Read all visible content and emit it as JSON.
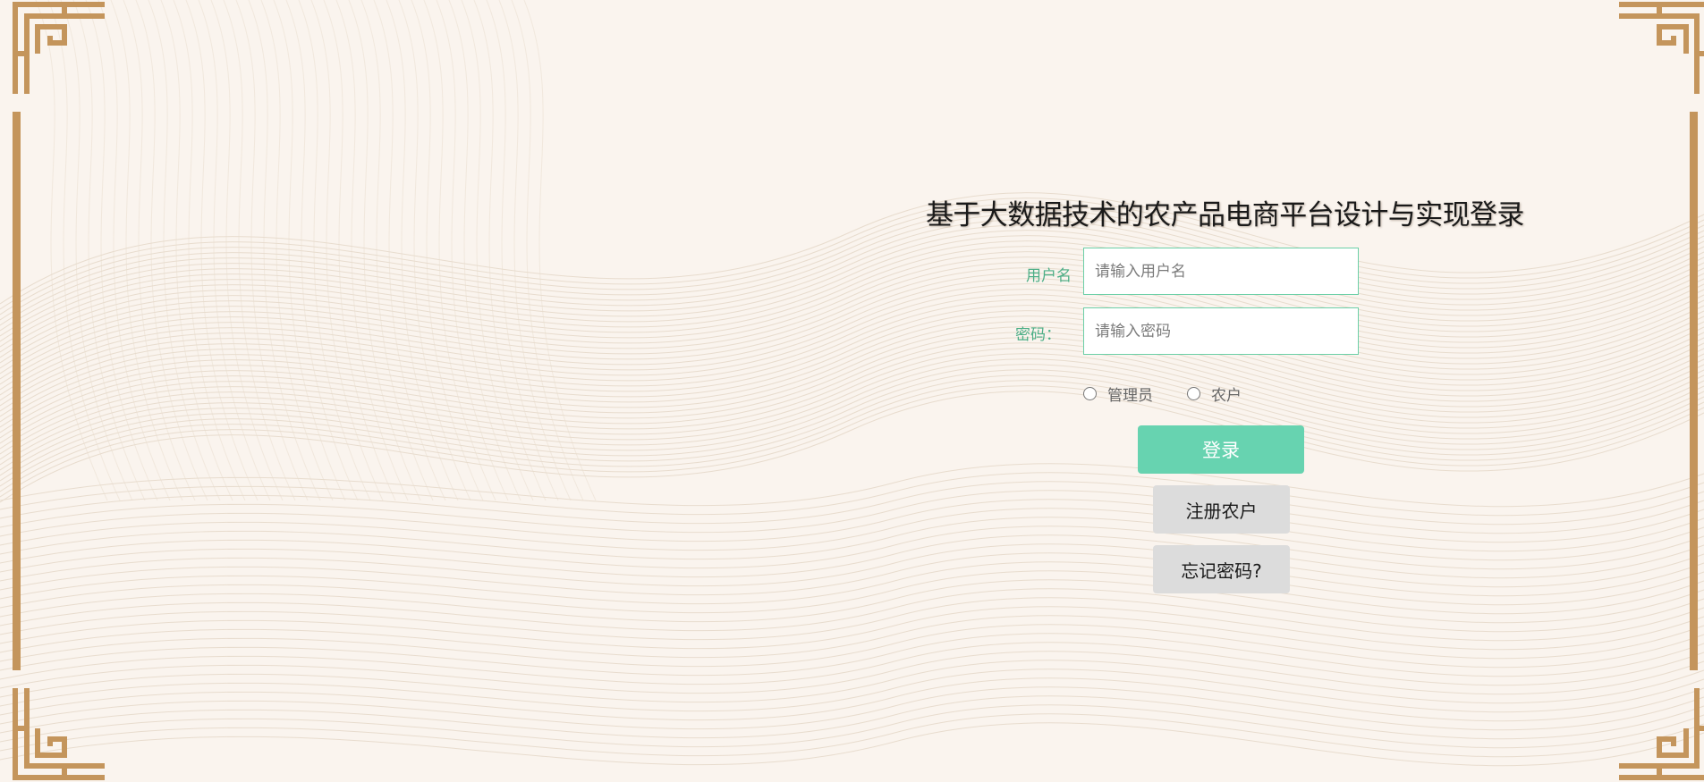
{
  "login": {
    "title": "基于大数据技术的农产品电商平台设计与实现登录",
    "username_label": "用户名",
    "username_placeholder": "请输入用户名",
    "password_label": "密码：",
    "password_placeholder": "请输入密码",
    "roles": [
      "管理员",
      "农户"
    ],
    "login_button": "登录",
    "register_button": "注册农户",
    "forgot_button": "忘记密码?"
  },
  "theme": {
    "background": "#faf4ee",
    "frame_color": "#c4955c",
    "accent": "#67d3b0",
    "label_color": "#4cae86"
  }
}
